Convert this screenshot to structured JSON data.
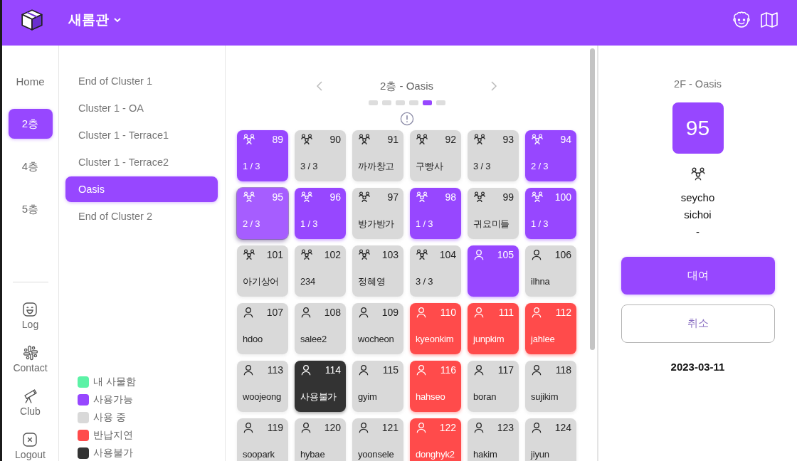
{
  "top_bar": {
    "building": "새롬관"
  },
  "nav": {
    "items": [
      {
        "label": "Home",
        "selected": false
      },
      {
        "label": "2층",
        "selected": true
      },
      {
        "label": "4층",
        "selected": false
      },
      {
        "label": "5층",
        "selected": false
      }
    ],
    "bottom_items": [
      {
        "label": "Log",
        "kind": "log"
      },
      {
        "label": "Contact",
        "kind": "contact"
      },
      {
        "label": "Club",
        "kind": "club"
      },
      {
        "label": "Logout",
        "kind": "logout"
      }
    ]
  },
  "clusters": {
    "items": [
      {
        "label": "End of Cluster 1",
        "selected": false
      },
      {
        "label": "Cluster 1 - OA",
        "selected": false
      },
      {
        "label": "Cluster 1 - Terrace1",
        "selected": false
      },
      {
        "label": "Cluster 1 - Terrace2",
        "selected": false
      },
      {
        "label": "Oasis",
        "selected": true
      },
      {
        "label": "End of Cluster 2",
        "selected": false
      }
    ],
    "legend": [
      {
        "label": "내 사물함",
        "color": "#5cf2a6"
      },
      {
        "label": "사용가능",
        "color": "#9747ff"
      },
      {
        "label": "사용 중",
        "color": "#d9d9d9"
      },
      {
        "label": "반납지연",
        "color": "#ff4b4b"
      },
      {
        "label": "사용불가",
        "color": "#333333"
      }
    ]
  },
  "main": {
    "title": "2층 - Oasis",
    "pages": [
      {
        "selected": false
      },
      {
        "selected": false
      },
      {
        "selected": false
      },
      {
        "selected": false
      },
      {
        "selected": true
      },
      {
        "selected": false
      }
    ],
    "rows": [
      {
        "cells": [
          {
            "number": "89",
            "kind": "shared",
            "color": "#9747ff",
            "selected": false,
            "label": "1 / 3"
          },
          {
            "number": "90",
            "kind": "shared",
            "color": "#d9d9d9",
            "selected": false,
            "label": "3 / 3"
          },
          {
            "number": "91",
            "kind": "shared",
            "color": "#d9d9d9",
            "selected": false,
            "label": "까까창고"
          },
          {
            "number": "92",
            "kind": "shared",
            "color": "#d9d9d9",
            "selected": false,
            "label": "구빵사"
          },
          {
            "number": "93",
            "kind": "shared",
            "color": "#d9d9d9",
            "selected": false,
            "label": "3 / 3"
          },
          {
            "number": "94",
            "kind": "shared",
            "color": "#9747ff",
            "selected": false,
            "label": "2 / 3"
          }
        ]
      },
      {
        "cells": [
          {
            "number": "95",
            "kind": "shared",
            "color": "#a65dff",
            "selected": true,
            "label": "2 / 3"
          },
          {
            "number": "96",
            "kind": "shared",
            "color": "#9747ff",
            "selected": false,
            "label": "1 / 3"
          },
          {
            "number": "97",
            "kind": "shared",
            "color": "#d9d9d9",
            "selected": false,
            "label": "방가방가"
          },
          {
            "number": "98",
            "kind": "shared",
            "color": "#9747ff",
            "selected": false,
            "label": "1 / 3"
          },
          {
            "number": "99",
            "kind": "shared",
            "color": "#d9d9d9",
            "selected": false,
            "label": "귀요미들"
          },
          {
            "number": "100",
            "kind": "shared",
            "color": "#9747ff",
            "selected": false,
            "label": "1 / 3"
          }
        ]
      },
      {
        "cells": [
          {
            "number": "101",
            "kind": "shared",
            "color": "#d9d9d9",
            "selected": false,
            "label": "아기상어"
          },
          {
            "number": "102",
            "kind": "shared",
            "color": "#d9d9d9",
            "selected": false,
            "label": "234"
          },
          {
            "number": "103",
            "kind": "shared",
            "color": "#d9d9d9",
            "selected": false,
            "label": "정혜영"
          },
          {
            "number": "104",
            "kind": "shared",
            "color": "#d9d9d9",
            "selected": false,
            "label": "3 / 3"
          },
          {
            "number": "105",
            "kind": "personal",
            "color": "#9747ff",
            "selected": false
          },
          {
            "number": "106",
            "kind": "personal",
            "color": "#d9d9d9",
            "selected": false,
            "label": "ilhna"
          }
        ]
      },
      {
        "cells": [
          {
            "number": "107",
            "kind": "personal",
            "color": "#d9d9d9",
            "selected": false,
            "label": "hdoo"
          },
          {
            "number": "108",
            "kind": "personal",
            "color": "#d9d9d9",
            "selected": false,
            "label": "salee2"
          },
          {
            "number": "109",
            "kind": "personal",
            "color": "#d9d9d9",
            "selected": false,
            "label": "wocheon"
          },
          {
            "number": "110",
            "kind": "personal",
            "color": "#ff4b4b",
            "selected": false,
            "label": "kyeonkim"
          },
          {
            "number": "111",
            "kind": "personal",
            "color": "#ff4b4b",
            "selected": false,
            "label": "junpkim"
          },
          {
            "number": "112",
            "kind": "personal",
            "color": "#ff4b4b",
            "selected": false,
            "label": "jahlee"
          }
        ]
      },
      {
        "cells": [
          {
            "number": "113",
            "kind": "personal",
            "color": "#d9d9d9",
            "selected": false,
            "label": "woojeong"
          },
          {
            "number": "114",
            "kind": "personal",
            "color": "#333333",
            "selected": false,
            "label": "사용불가"
          },
          {
            "number": "115",
            "kind": "personal",
            "color": "#d9d9d9",
            "selected": false,
            "label": "gyim"
          },
          {
            "number": "116",
            "kind": "personal",
            "color": "#ff4b4b",
            "selected": false,
            "label": "hahseo"
          },
          {
            "number": "117",
            "kind": "personal",
            "color": "#d9d9d9",
            "selected": false,
            "label": "boran"
          },
          {
            "number": "118",
            "kind": "personal",
            "color": "#d9d9d9",
            "selected": false,
            "label": "sujikim"
          }
        ]
      },
      {
        "cells": [
          {
            "number": "119",
            "kind": "personal",
            "color": "#d9d9d9",
            "selected": false,
            "label": "soopark"
          },
          {
            "number": "120",
            "kind": "personal",
            "color": "#d9d9d9",
            "selected": false,
            "label": "hybae"
          },
          {
            "number": "121",
            "kind": "personal",
            "color": "#d9d9d9",
            "selected": false,
            "label": "yoonsele"
          },
          {
            "number": "122",
            "kind": "personal",
            "color": "#ff4b4b",
            "selected": false,
            "label": "donghyk2"
          },
          {
            "number": "123",
            "kind": "personal",
            "color": "#d9d9d9",
            "selected": false,
            "label": "hakim"
          },
          {
            "number": "124",
            "kind": "personal",
            "color": "#d9d9d9",
            "selected": false,
            "label": "jiyun"
          }
        ]
      }
    ]
  },
  "detail": {
    "title": "2F - Oasis",
    "number": "95",
    "kind": "shared",
    "users": [
      "seycho",
      "sichoi",
      "-"
    ],
    "buttons": [
      {
        "label": "대여",
        "kind": "primary"
      },
      {
        "label": "취소",
        "kind": "secondary"
      }
    ],
    "date": "2023-03-11"
  }
}
